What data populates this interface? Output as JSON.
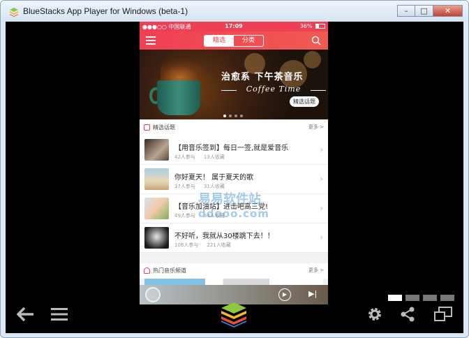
{
  "window": {
    "title": "BlueStacks App Player for Windows (beta-1)",
    "minimize_label": "–",
    "maximize_label": "□",
    "close_label": "✕"
  },
  "status_bar": {
    "carrier": "●●●○○ 中国联通",
    "time": "17:09",
    "battery": "36%"
  },
  "nav": {
    "tabs": [
      {
        "label": "精选",
        "active": true
      },
      {
        "label": "分类",
        "active": false
      }
    ]
  },
  "banner": {
    "title_cn": "治愈系 下午茶音乐",
    "title_en": "Coffee Time",
    "tag": "精选话题"
  },
  "featured": {
    "section_label": "精选话题",
    "more_label": "更多 >",
    "items": [
      {
        "title": "【用音乐签到】每日一签,就是爱音乐",
        "participants": "42人参与",
        "favorites": "13人收藏"
      },
      {
        "title": "你好夏天！ 属于夏天的歌",
        "participants": "37人参与",
        "favorites": "31人收藏"
      },
      {
        "title": "【音乐加油站】进击吧高三党!",
        "participants": "49人参与",
        "favorites": "34人收藏"
      },
      {
        "title": "不好听，我就从30楼跳下去！！",
        "participants": "106人参与",
        "favorites": "221人收藏"
      }
    ]
  },
  "channels": {
    "section_label": "热门音乐频道",
    "more_label": "更多 >"
  },
  "watermark": {
    "cn": "易易软件站",
    "en": "ddooo.com"
  },
  "colors": {
    "accent": "#ef3f55",
    "emulator_bg": "#000000"
  }
}
